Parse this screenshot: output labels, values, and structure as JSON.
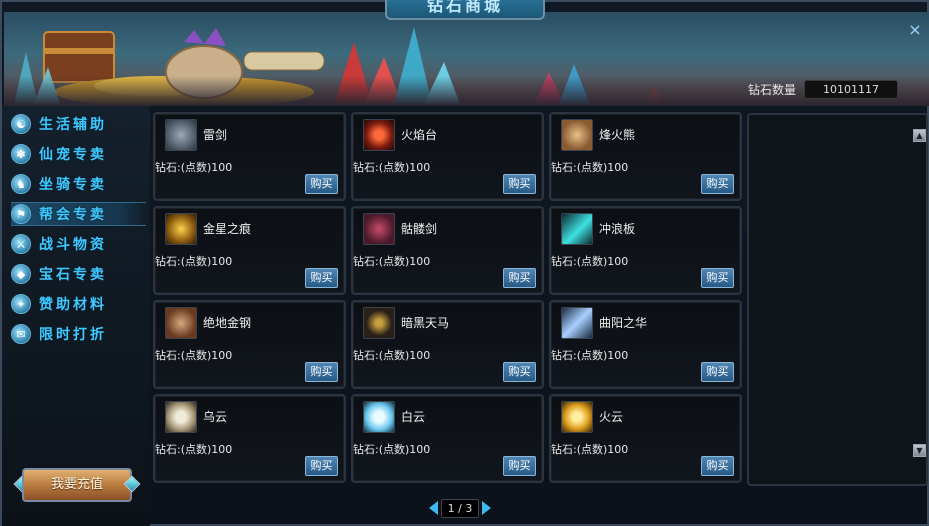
{
  "window": {
    "title": "钻石商城",
    "close_glyph": "×",
    "accent_color": "#40c8ff"
  },
  "header": {
    "diamond_label": "钻石数量",
    "diamond_value": "10101117"
  },
  "sidebar": {
    "items": [
      {
        "label": "生活辅助",
        "icon": "life-assist-icon",
        "active": false
      },
      {
        "label": "仙宠专卖",
        "icon": "pet-paw-icon",
        "active": false
      },
      {
        "label": "坐骑专卖",
        "icon": "mount-horse-icon",
        "active": false
      },
      {
        "label": "帮会专卖",
        "icon": "guild-icon",
        "active": true
      },
      {
        "label": "战斗物资",
        "icon": "battle-supply-icon",
        "active": false
      },
      {
        "label": "宝石专卖",
        "icon": "gem-icon",
        "active": false
      },
      {
        "label": "赞助材料",
        "icon": "sponsor-material-icon",
        "active": false
      },
      {
        "label": "限时打折",
        "icon": "megaphone-icon",
        "active": false
      }
    ],
    "recharge_label": "我要充值"
  },
  "items": [
    {
      "name": "雷剑",
      "price": "钻石:(点数)100",
      "buy": "购买",
      "icon": "thunder-sword-icon"
    },
    {
      "name": "火焰台",
      "price": "钻石:(点数)100",
      "buy": "购买",
      "icon": "flame-altar-icon"
    },
    {
      "name": "烽火熊",
      "price": "钻石:(点数)100",
      "buy": "购买",
      "icon": "beacon-bear-icon"
    },
    {
      "name": "金星之痕",
      "price": "钻石:(点数)100",
      "buy": "购买",
      "icon": "golden-star-mark-icon"
    },
    {
      "name": "骷髅剑",
      "price": "钻石:(点数)100",
      "buy": "购买",
      "icon": "skull-sword-icon"
    },
    {
      "name": "冲浪板",
      "price": "钻石:(点数)100",
      "buy": "购买",
      "icon": "surfboard-icon"
    },
    {
      "name": "绝地金钢",
      "price": "钻石:(点数)100",
      "buy": "购买",
      "icon": "jedi-king-kong-icon"
    },
    {
      "name": "暗黑天马",
      "price": "钻石:(点数)100",
      "buy": "购买",
      "icon": "dark-pegasus-icon"
    },
    {
      "name": "曲阳之华",
      "price": "钻石:(点数)100",
      "buy": "购买",
      "icon": "quyang-splendor-icon"
    },
    {
      "name": "乌云",
      "price": "钻石:(点数)100",
      "buy": "购买",
      "icon": "dark-cloud-icon"
    },
    {
      "name": "白云",
      "price": "钻石:(点数)100",
      "buy": "购买",
      "icon": "white-cloud-icon"
    },
    {
      "name": "火云",
      "price": "钻石:(点数)100",
      "buy": "购买",
      "icon": "fire-cloud-icon"
    }
  ],
  "right_panel": {
    "scroll_up_glyph": "▲",
    "scroll_down_glyph": "▼"
  },
  "pager": {
    "page_text": "1 / 3"
  }
}
